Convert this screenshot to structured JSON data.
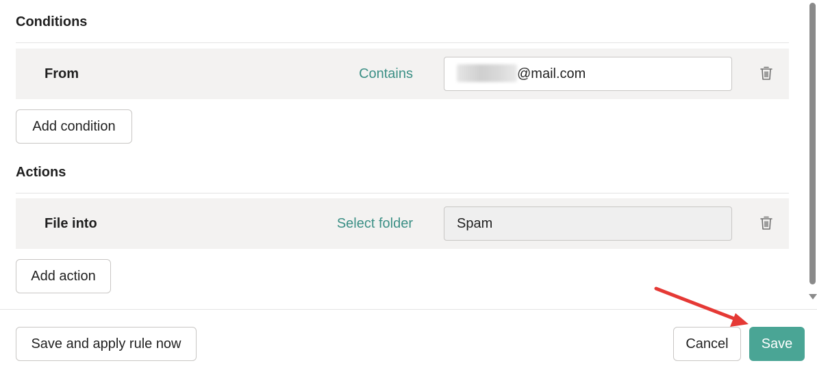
{
  "conditions": {
    "title": "Conditions",
    "rows": [
      {
        "field": "From",
        "operator": "Contains",
        "value_visible": "@mail.com",
        "value_redacted": true
      }
    ],
    "add_label": "Add condition"
  },
  "actions": {
    "title": "Actions",
    "rows": [
      {
        "field": "File into",
        "operator": "Select folder",
        "value": "Spam"
      }
    ],
    "add_label": "Add action"
  },
  "footer": {
    "save_apply_label": "Save and apply rule now",
    "cancel_label": "Cancel",
    "save_label": "Save"
  },
  "icons": {
    "delete": "trash-icon",
    "annotation": "red-arrow-annotation"
  },
  "colors": {
    "accent": "#4aa595",
    "link": "#3b8f85",
    "row_bg": "#f3f2f1",
    "annotation_arrow": "#e53935"
  }
}
